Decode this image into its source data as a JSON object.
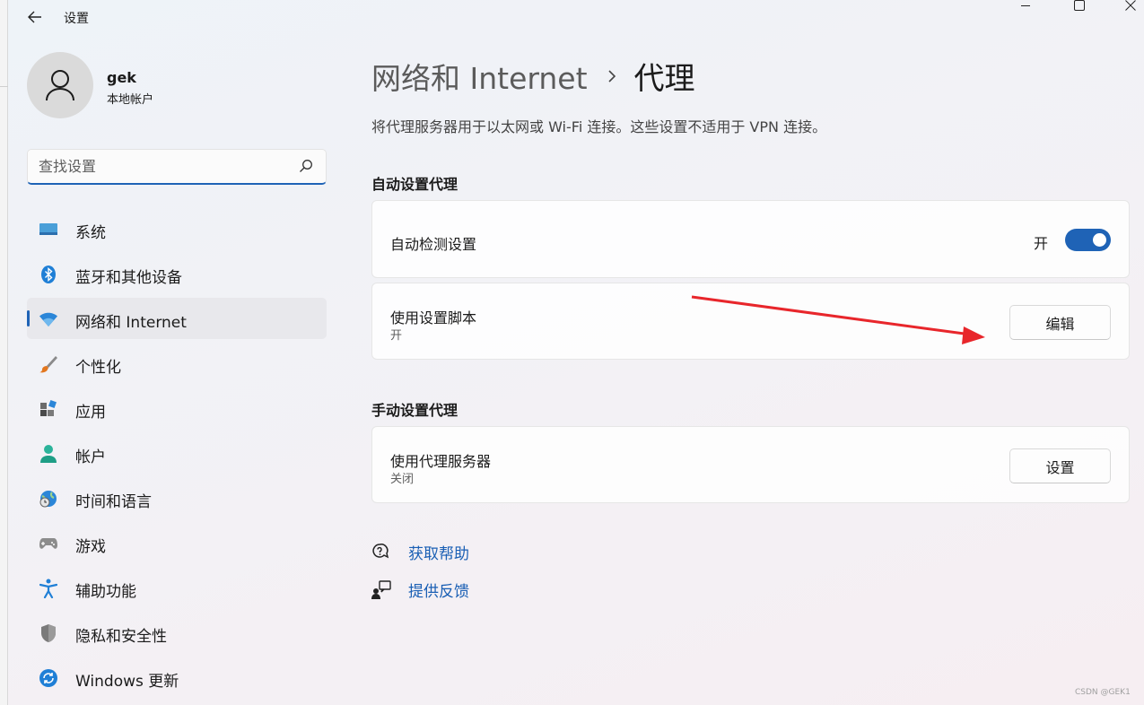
{
  "window": {
    "title": "设置",
    "back_icon": "arrow-left-icon",
    "controls": [
      "minimize-icon",
      "maximize-icon",
      "close-icon"
    ]
  },
  "user": {
    "name": "gek",
    "account_type": "本地帐户",
    "avatar_icon": "person-icon"
  },
  "search": {
    "placeholder": "查找设置",
    "value": "",
    "icon": "search-icon"
  },
  "sidebar": {
    "active_index": 2,
    "items": [
      {
        "label": "系统",
        "icon": "monitor-icon"
      },
      {
        "label": "蓝牙和其他设备",
        "icon": "bluetooth-icon"
      },
      {
        "label": "网络和 Internet",
        "icon": "wifi-icon"
      },
      {
        "label": "个性化",
        "icon": "brush-icon"
      },
      {
        "label": "应用",
        "icon": "apps-icon"
      },
      {
        "label": "帐户",
        "icon": "account-icon"
      },
      {
        "label": "时间和语言",
        "icon": "globe-clock-icon"
      },
      {
        "label": "游戏",
        "icon": "gamepad-icon"
      },
      {
        "label": "辅助功能",
        "icon": "accessibility-icon"
      },
      {
        "label": "隐私和安全性",
        "icon": "shield-icon"
      },
      {
        "label": "Windows 更新",
        "icon": "update-icon"
      }
    ]
  },
  "main": {
    "breadcrumb": {
      "parent": "网络和 Internet",
      "current": "代理"
    },
    "description": "将代理服务器用于以太网或 Wi-Fi 连接。这些设置不适用于 VPN 连接。",
    "auto_section": {
      "title": "自动设置代理",
      "detect": {
        "label": "自动检测设置",
        "state_label": "开",
        "enabled": true
      },
      "script": {
        "label": "使用设置脚本",
        "status": "开",
        "button": "编辑"
      }
    },
    "manual_section": {
      "title": "手动设置代理",
      "proxy": {
        "label": "使用代理服务器",
        "status": "关闭",
        "button": "设置"
      }
    },
    "links": [
      {
        "label": "获取帮助",
        "icon": "help-chat-icon"
      },
      {
        "label": "提供反馈",
        "icon": "feedback-icon"
      }
    ]
  },
  "annotation": {
    "color": "#e8262b"
  },
  "colors": {
    "accent": "#1f63b6",
    "link": "#1a5fb4"
  },
  "watermark": "CSDN @GEK1"
}
